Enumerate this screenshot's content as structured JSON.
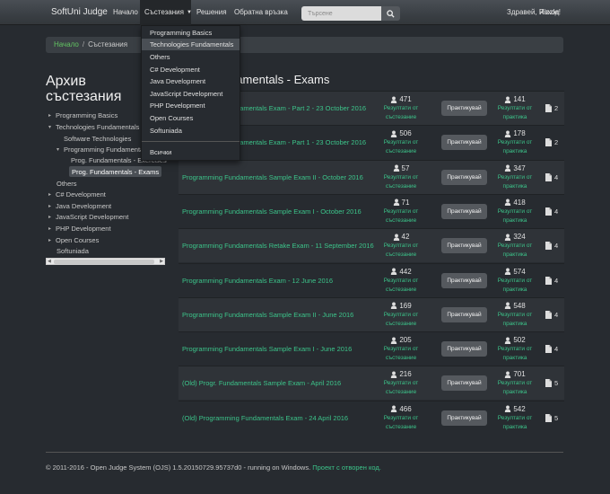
{
  "navbar": {
    "brand": "SoftUni Judge",
    "items": [
      {
        "label": "Начало"
      },
      {
        "label": "Състезания"
      },
      {
        "label": "Решения"
      },
      {
        "label": "Обратна връзка"
      }
    ],
    "search_placeholder": "Търсене",
    "greeting": "Здравей, Rizzle!",
    "logout": "Изход"
  },
  "breadcrumb": {
    "home": "Начало",
    "separator": "/",
    "current": "Състезания"
  },
  "sidebar": {
    "title_line1": "Архив",
    "title_line2": "състезания",
    "tree": [
      {
        "label": "Programming Basics",
        "toggle": "▸"
      },
      {
        "label": "Technologies Fundamentals",
        "toggle": "▾"
      },
      {
        "label": "Software Technologies",
        "toggle": ""
      },
      {
        "label": "Programming Fundamentals",
        "toggle": "▾"
      },
      {
        "label": "Prog. Fundamentals - Exercises",
        "toggle": ""
      },
      {
        "label": "Prog. Fundamentals - Exams",
        "toggle": ""
      },
      {
        "label": "Others",
        "toggle": ""
      },
      {
        "label": "C# Development",
        "toggle": "▸"
      },
      {
        "label": "Java Development",
        "toggle": "▸"
      },
      {
        "label": "JavaScript Development",
        "toggle": "▸"
      },
      {
        "label": "PHP Development",
        "toggle": "▸"
      },
      {
        "label": "Open Courses",
        "toggle": "▸"
      },
      {
        "label": "Softuniada",
        "toggle": ""
      }
    ]
  },
  "dropdown": {
    "items": [
      {
        "label": "Programming Basics"
      },
      {
        "label": "Technologies Fundamentals"
      },
      {
        "label": "Others"
      },
      {
        "label": "C# Development"
      },
      {
        "label": "Java Development"
      },
      {
        "label": "JavaScript Development"
      },
      {
        "label": "PHP Development"
      },
      {
        "label": "Open Courses"
      },
      {
        "label": "Softuniada"
      },
      {
        "label": "Всички"
      }
    ]
  },
  "main": {
    "heading": "Prog. Fundamentals - Exams",
    "results_label": "Резултати от състезание",
    "practice_results_label": "Резултати от практика",
    "practice_button": "Практикувай",
    "contests": [
      {
        "name": "Programming Fundamentals Exam - Part 2 - 23 October 2016",
        "contest_count": "471",
        "practice_count": "141",
        "files": "2"
      },
      {
        "name": "Programming Fundamentals Exam - Part 1 - 23 October 2016",
        "contest_count": "506",
        "practice_count": "178",
        "files": "2"
      },
      {
        "name": "Programming Fundamentals Sample Exam II - October 2016",
        "contest_count": "57",
        "practice_count": "347",
        "files": "4"
      },
      {
        "name": "Programming Fundamentals Sample Exam I - October 2016",
        "contest_count": "71",
        "practice_count": "418",
        "files": "4"
      },
      {
        "name": "Programming Fundamentals Retake Exam - 11 September 2016",
        "contest_count": "42",
        "practice_count": "324",
        "files": "4"
      },
      {
        "name": "Programming Fundamentals Exam - 12 June 2016",
        "contest_count": "442",
        "practice_count": "574",
        "files": "4"
      },
      {
        "name": "Programming Fundamentals Sample Exam II - June 2016",
        "contest_count": "169",
        "practice_count": "548",
        "files": "4"
      },
      {
        "name": "Programming Fundamentals Sample Exam I - June 2016",
        "contest_count": "205",
        "practice_count": "502",
        "files": "4"
      },
      {
        "name": "(Old) Progr. Fundamentals Sample Exam - April 2016",
        "contest_count": "216",
        "practice_count": "701",
        "files": "5"
      },
      {
        "name": "(Old) Programming Fundamentals Exam - 24 April 2016",
        "contest_count": "466",
        "practice_count": "542",
        "files": "5"
      }
    ]
  },
  "footer": {
    "text": "© 2011-2016 - Open Judge System (OJS) 1.5.20150729.95737d0 - running on Windows.",
    "link": "Проект с отворен код."
  },
  "colors": {
    "accent": "#3cc48a",
    "background": "#272b30",
    "navbar": "#3a3f44"
  }
}
